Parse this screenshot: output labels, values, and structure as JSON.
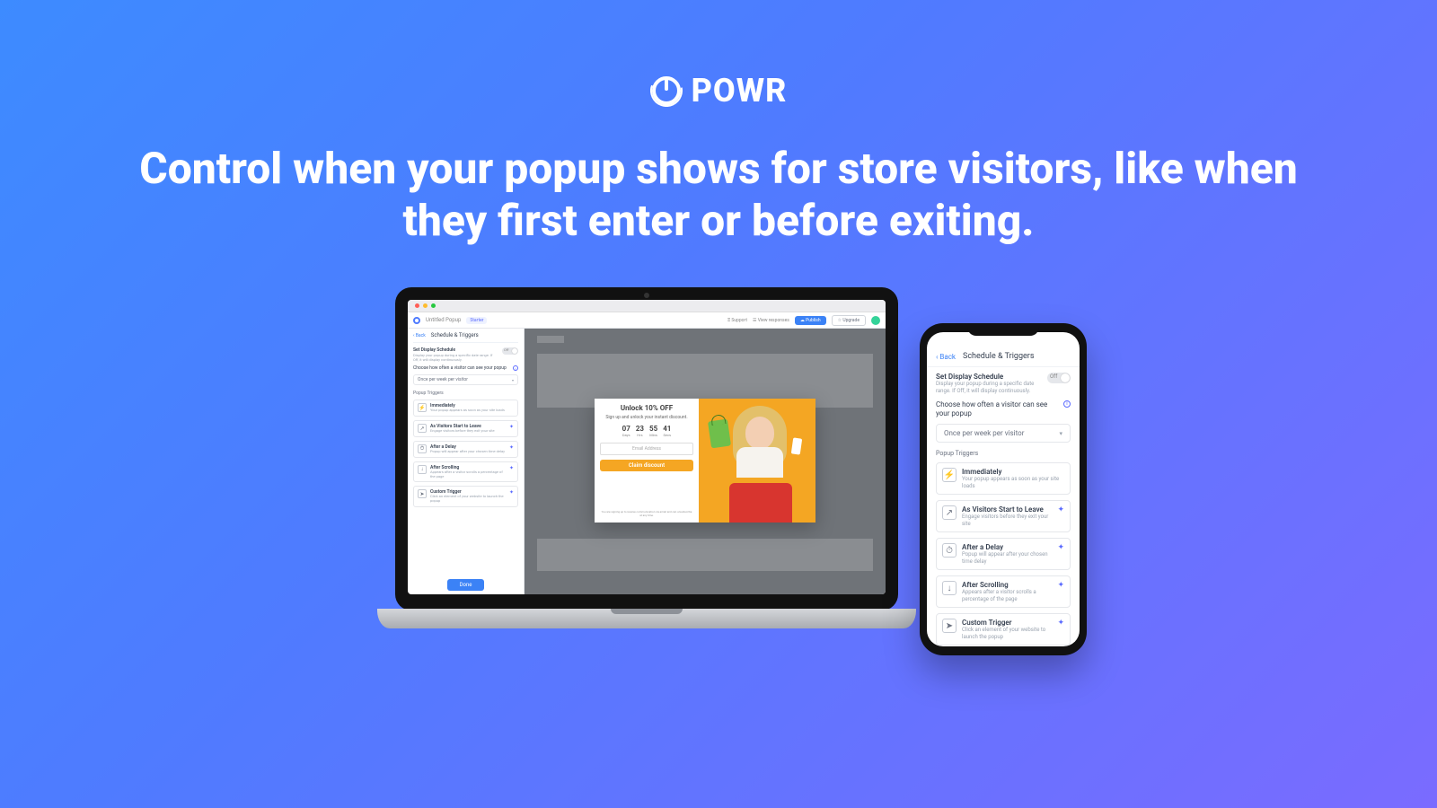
{
  "brand": {
    "name": "POWR"
  },
  "headline": "Control when your popup shows for store visitors, like when they first enter or before exiting.",
  "app": {
    "doc_title": "Untitled Popup",
    "status_badge": "Starter",
    "support": "Support",
    "view_responses": "View responses",
    "publish": "Publish",
    "upgrade": "Upgrade"
  },
  "panel": {
    "back": "Back",
    "title": "Schedule & Triggers",
    "schedule_label": "Set Display Schedule",
    "schedule_desc": "Display your popup during a specific date range. If Off, it will display continuously.",
    "schedule_toggle_state": "Off",
    "frequency_label": "Choose how often a visitor can see your popup",
    "frequency_value": "Once per week per visitor",
    "triggers_header": "Popup Triggers",
    "done": "Done",
    "triggers": [
      {
        "icon": "⚡",
        "title": "Immediately",
        "desc": "Your popup appears as soon as your site loads",
        "starred": false
      },
      {
        "icon": "↗",
        "title": "As Visitors Start to Leave",
        "desc": "Engage visitors before they exit your site",
        "starred": true
      },
      {
        "icon": "⏱",
        "title": "After a Delay",
        "desc": "Popup will appear after your chosen time delay",
        "starred": true
      },
      {
        "icon": "↓",
        "title": "After Scrolling",
        "desc": "Appears after a visitor scrolls a percentage of the page",
        "starred": true
      },
      {
        "icon": "➤",
        "title": "Custom Trigger",
        "desc": "Click an element of your website to launch the popup",
        "starred": true
      }
    ]
  },
  "popup": {
    "title": "Unlock 10% OFF",
    "subtitle": "Sign up and unlock your instant discount.",
    "countdown": [
      {
        "n": "07",
        "l": "Days"
      },
      {
        "n": "23",
        "l": "Hrs"
      },
      {
        "n": "55",
        "l": "Mins"
      },
      {
        "n": "41",
        "l": "Secs"
      }
    ],
    "email_placeholder": "Email Address",
    "cta": "Claim discount",
    "footnote": "You are signing up to receive communication via email and can unsubscribe at any time."
  }
}
